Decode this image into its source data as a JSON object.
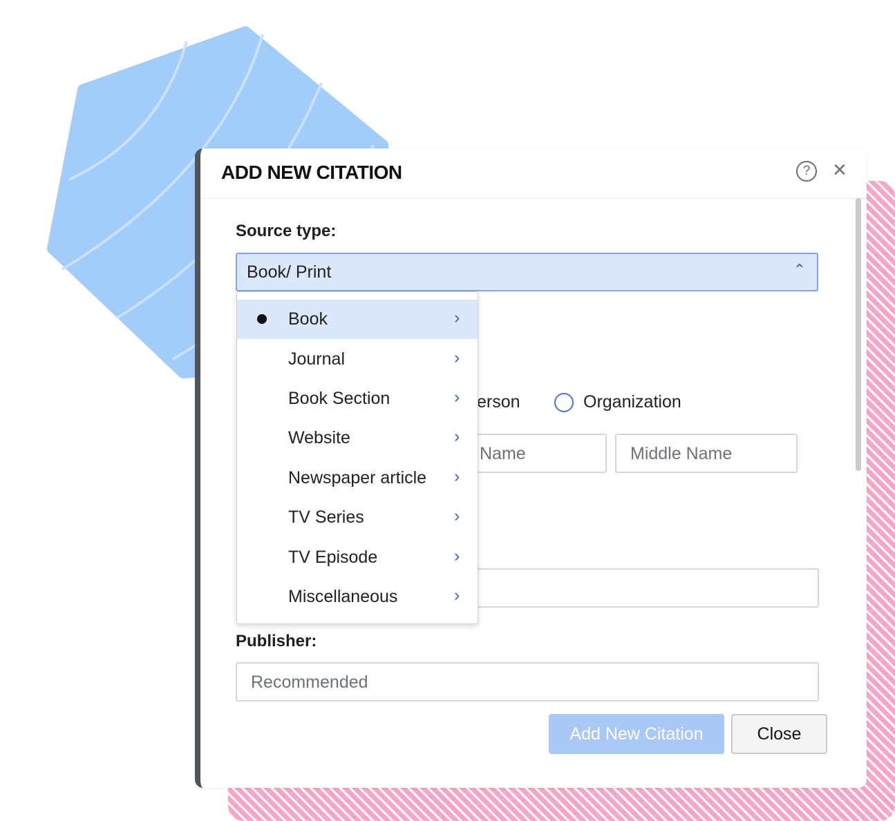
{
  "dialog": {
    "title": "ADD NEW CITATION",
    "help_icon": "help-circle-icon",
    "close_icon": "close-icon"
  },
  "source_type": {
    "label": "Source type:",
    "value": "Book/ Print",
    "chevron_icon": "chevron-up-icon"
  },
  "dropdown": {
    "items": [
      {
        "label": "Book",
        "selected": true
      },
      {
        "label": "Journal",
        "selected": false
      },
      {
        "label": "Book Section",
        "selected": false
      },
      {
        "label": "Website",
        "selected": false
      },
      {
        "label": "Newspaper article",
        "selected": false
      },
      {
        "label": "TV Series",
        "selected": false
      },
      {
        "label": "TV Episode",
        "selected": false
      },
      {
        "label": "Miscellaneous",
        "selected": false
      }
    ]
  },
  "contributor": {
    "person_label_partial": "erson",
    "organization_label": "Organization",
    "first_name_placeholder_partial": "Name",
    "middle_name_placeholder": "Middle Name"
  },
  "publisher": {
    "label": "Publisher:",
    "placeholder": "Recommended"
  },
  "buttons": {
    "add_label": "Add New Citation",
    "close_label": "Close"
  },
  "colors": {
    "accent": "#6aa0ee",
    "select_bg": "#dbe8fb",
    "pink_pattern": "#f7a6c6",
    "hexagon": "#a2cdfa"
  }
}
